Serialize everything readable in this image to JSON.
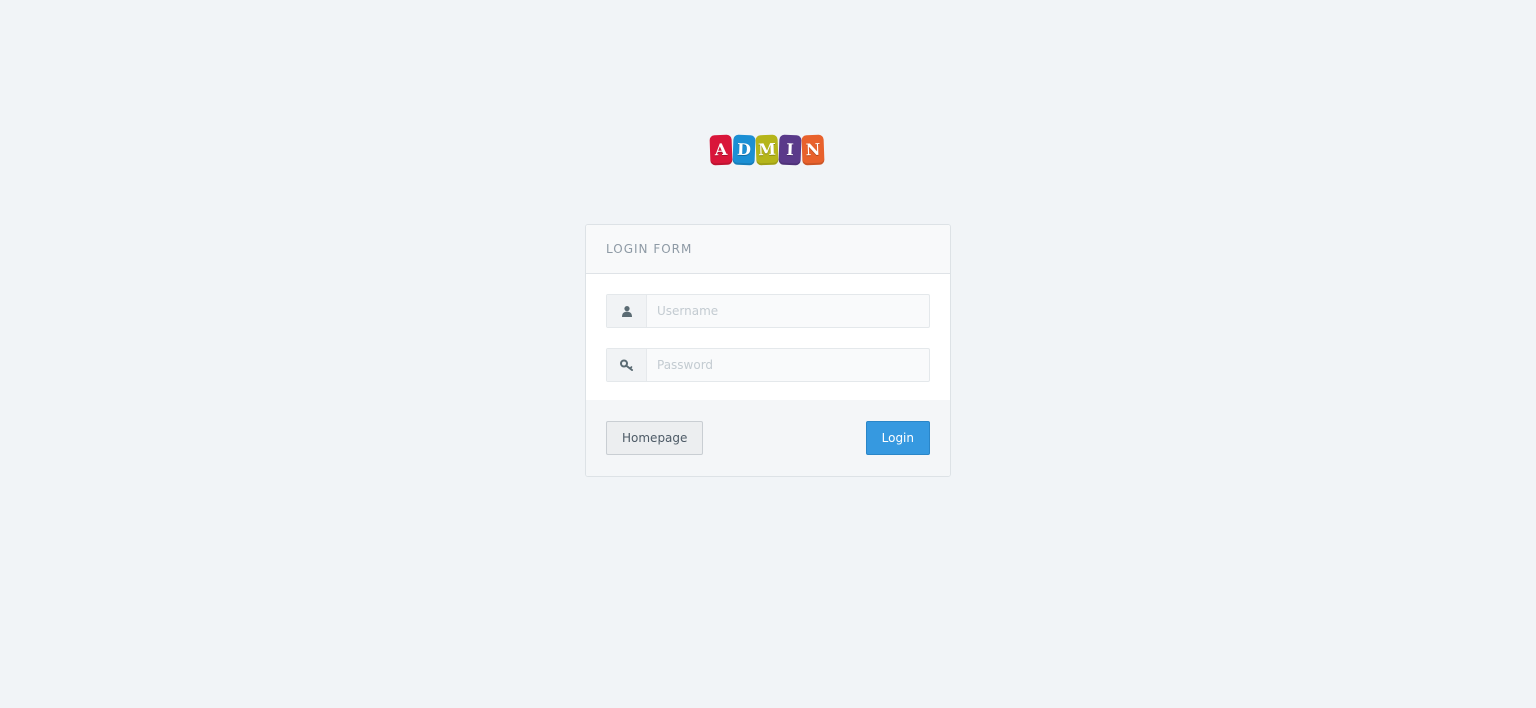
{
  "logo": {
    "letters": [
      {
        "char": "A",
        "color": "#d9163a"
      },
      {
        "char": "D",
        "color": "#1b8fd4"
      },
      {
        "char": "M",
        "color": "#b5b51a"
      },
      {
        "char": "I",
        "color": "#5a3a8a"
      },
      {
        "char": "N",
        "color": "#e8612c"
      }
    ]
  },
  "login": {
    "heading": "LOGIN FORM",
    "username": {
      "placeholder": "Username",
      "value": "",
      "icon": "user-icon"
    },
    "password": {
      "placeholder": "Password",
      "value": "",
      "icon": "key-icon"
    },
    "homepage_label": "Homepage",
    "login_label": "Login"
  },
  "colors": {
    "background": "#f1f4f7",
    "primary": "#3699e0"
  }
}
